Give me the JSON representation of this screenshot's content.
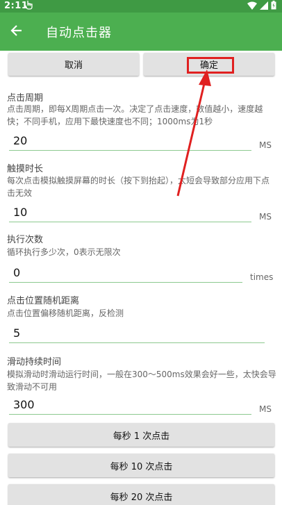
{
  "status_bar": {
    "time": "2:11",
    "icons": [
      "hand-touch-icon",
      "wifi-icon",
      "signal-icon",
      "battery-icon"
    ]
  },
  "app_bar": {
    "title": "自动点击器",
    "back_icon": "arrow-left-icon"
  },
  "actions": {
    "cancel": "取消",
    "confirm": "确定"
  },
  "settings": [
    {
      "label": "点击周期",
      "description": "点击周期，即每X周期点击一次。决定了点击速度，数值越小，速度越快；不同手机，应用下最快速度也不同；1000ms为1秒",
      "value": "20",
      "unit": "MS"
    },
    {
      "label": "触摸时长",
      "description": "每次点击模拟触摸屏幕的时长（按下到抬起），太短会导致部分应用下点击无效",
      "value": "10",
      "unit": "MS"
    },
    {
      "label": "执行次数",
      "description": "循环执行多少次，0表示无限次",
      "value": "0",
      "unit": "times"
    },
    {
      "label": "点击位置随机距离",
      "description": "点击位置偏移随机距离，反检测",
      "value": "5",
      "unit": ""
    },
    {
      "label": "滑动持续时间",
      "description": "模拟滑动时滑动运行时间，一般在300～500ms效果会好一些，太快会导致滑动不可用",
      "value": "300",
      "unit": "MS"
    }
  ],
  "presets": [
    "每秒 1 次点击",
    "每秒 10 次点击",
    "每秒 20 次点击"
  ],
  "colors": {
    "app_bar": "#4caf50",
    "status_bar": "#3f9a44",
    "field_underline": "#8cc98f",
    "annotation": "#e02020"
  }
}
